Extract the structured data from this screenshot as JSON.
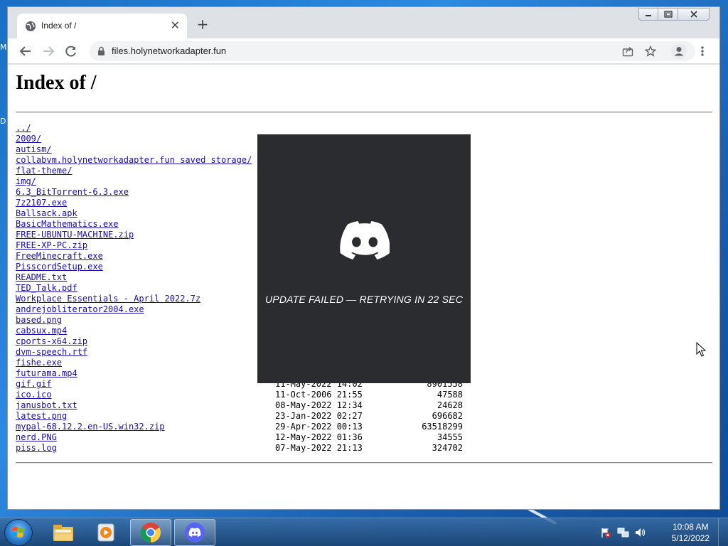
{
  "desktop": {
    "edge_labels": [
      "M",
      "D"
    ]
  },
  "browser": {
    "tab": {
      "title": "Index of /",
      "close": "✕"
    },
    "new_tab": "+",
    "url": "files.holynetworkadapter.fun"
  },
  "page": {
    "heading": "Index of /",
    "entries": [
      {
        "name": "../",
        "date": "",
        "size": ""
      },
      {
        "name": "2009/",
        "date": "",
        "size": ""
      },
      {
        "name": "autism/",
        "date": "",
        "size": ""
      },
      {
        "name": "collabvm.holynetworkadapter.fun saved storage/",
        "date": "",
        "size": ""
      },
      {
        "name": "flat-theme/",
        "date": "",
        "size": ""
      },
      {
        "name": "img/",
        "date": "",
        "size": ""
      },
      {
        "name": "6.3_BitTorrent-6.3.exe",
        "date": "",
        "size": ""
      },
      {
        "name": "7z2107.exe",
        "date": "",
        "size": ""
      },
      {
        "name": "Ballsack.apk",
        "date": "",
        "size": ""
      },
      {
        "name": "BasicMathematics.exe",
        "date": "",
        "size": ""
      },
      {
        "name": "FREE-UBUNTU-MACHINE.zip",
        "date": "",
        "size": ""
      },
      {
        "name": "FREE-XP-PC.zip",
        "date": "",
        "size": ""
      },
      {
        "name": "FreeMinecraft.exe",
        "date": "",
        "size": ""
      },
      {
        "name": "PisscordSetup.exe",
        "date": "",
        "size": ""
      },
      {
        "name": "README.txt",
        "date": "",
        "size": ""
      },
      {
        "name": "TED_Talk.pdf",
        "date": "",
        "size": ""
      },
      {
        "name": "Workplace Essentials - April 2022.7z",
        "date": "",
        "size": ""
      },
      {
        "name": "andrejobliterator2004.exe",
        "date": "",
        "size": ""
      },
      {
        "name": "based.png",
        "date": "",
        "size": ""
      },
      {
        "name": "cabsux.mp4",
        "date": "",
        "size": ""
      },
      {
        "name": "cports-x64.zip",
        "date": "",
        "size": ""
      },
      {
        "name": "dvm-speech.rtf",
        "date": "",
        "size": ""
      },
      {
        "name": "fishe.exe",
        "date": "",
        "size": ""
      },
      {
        "name": "futurama.mp4",
        "date": "",
        "size": ""
      },
      {
        "name": "gif.gif",
        "date": "11-May-2022 14:02",
        "size": "8901558"
      },
      {
        "name": "ico.ico",
        "date": "11-Oct-2006 21:55",
        "size": "47588"
      },
      {
        "name": "janusbot.txt",
        "date": "08-May-2022 12:34",
        "size": "24628"
      },
      {
        "name": "latest.png",
        "date": "23-Jan-2022 02:27",
        "size": "696682"
      },
      {
        "name": "mypal-68.12.2.en-US.win32.zip",
        "date": "29-Apr-2022 00:13",
        "size": "63518299"
      },
      {
        "name": "nerd.PNG",
        "date": "12-May-2022 01:36",
        "size": "34555"
      },
      {
        "name": "piss.log",
        "date": "07-May-2022 21:13",
        "size": "324702"
      }
    ]
  },
  "discord_overlay": {
    "message": "UPDATE FAILED — RETRYING IN 22 SEC",
    "icon": "discord-logo-icon"
  },
  "taskbar": {
    "apps": [
      "explorer-icon",
      "media-player-icon",
      "chrome-icon",
      "discord-icon"
    ],
    "time": "10:08 AM",
    "date": "5/12/2022"
  },
  "colors": {
    "link": "#1a0dab",
    "discord_bg": "#2a2c30",
    "taskbar": "#1c4778"
  }
}
